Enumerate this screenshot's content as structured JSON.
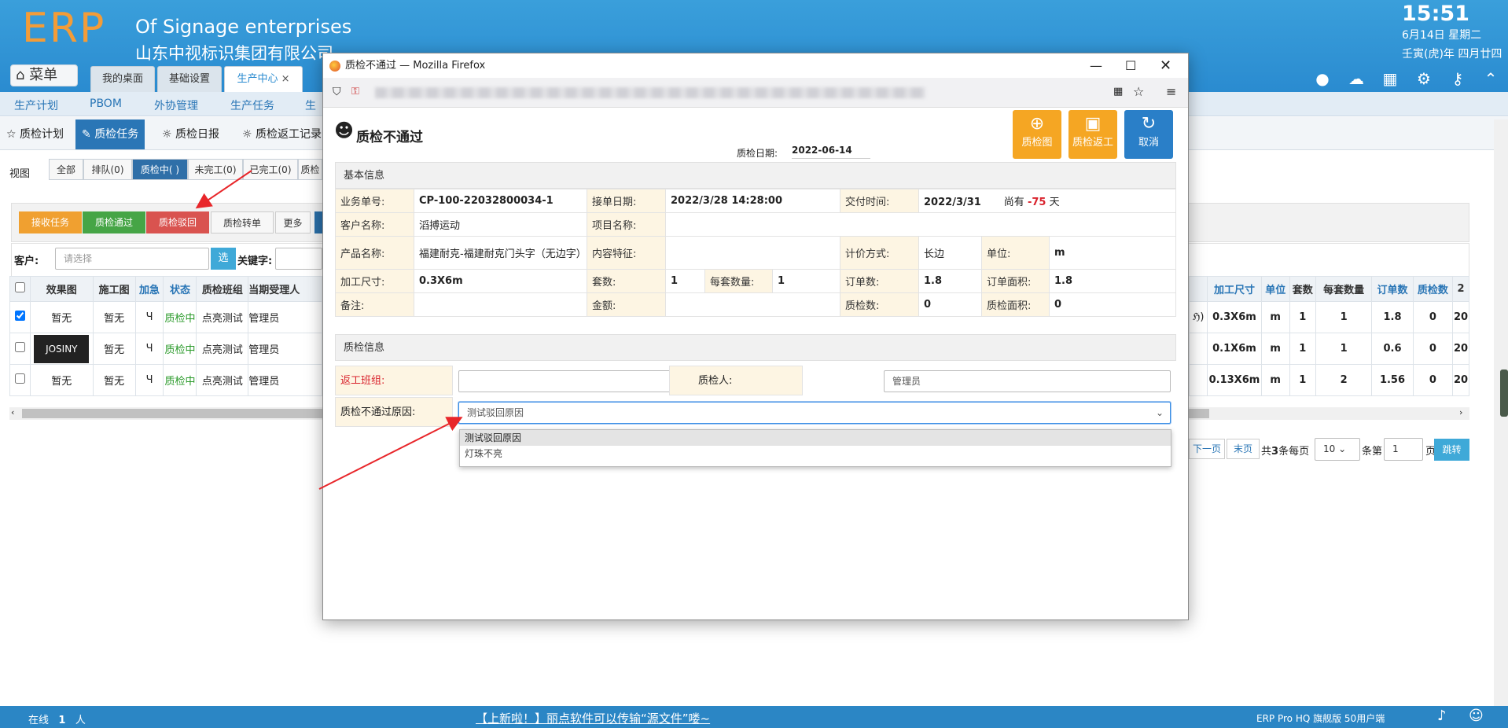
{
  "header": {
    "logo": "ERP",
    "company_en": "Of Signage enterprises",
    "company_cn": "山东中视标识集团有限公司",
    "time": "15:51",
    "date": "6月14日 星期二",
    "lunar": "壬寅(虎)年 四月廿四",
    "menu_label": "菜单",
    "tabs": [
      {
        "label": "我的桌面"
      },
      {
        "label": "基础设置"
      },
      {
        "label": "生产中心"
      }
    ]
  },
  "nav2": {
    "items": [
      "生产计划",
      "PBOM",
      "外协管理",
      "生产任务",
      "生"
    ]
  },
  "nav3": {
    "items": [
      "质检计划",
      "质检任务",
      "质检日报",
      "质检返工记录"
    ]
  },
  "filters": {
    "view_label": "视图",
    "items": [
      "全部",
      "排队(0)",
      "质检中( )",
      "未完工(0)",
      "已完工(0)",
      "质检"
    ]
  },
  "actions": {
    "items": [
      "接收任务",
      "质检通过",
      "质检驳回",
      "质检转单",
      "更多"
    ]
  },
  "search": {
    "customer_label": "客户:",
    "customer_placeholder": "请选择",
    "select_btn": "选",
    "keyword_label": "关键字:"
  },
  "table": {
    "headers_left": [
      "",
      "效果图",
      "施工图",
      "加急",
      "状态",
      "质检班组",
      "当期受理人"
    ],
    "headers_right": [
      "加工尺寸",
      "单位",
      "套数",
      "每套数量",
      "订单数",
      "质检数",
      "2"
    ],
    "rows": [
      {
        "effect": "暂无",
        "drawing": "暂无",
        "urgent": "Ч",
        "status": "质检中",
        "team": "点亮测试",
        "handler": "管理员",
        "tail": "ℌ)",
        "size": "0.3X6m",
        "unit": "m",
        "sets": "1",
        "per": "1",
        "orders": "1.8",
        "qc": "0",
        "x": "20"
      },
      {
        "effect": "JOSINY",
        "drawing": "暂无",
        "urgent": "Ч",
        "status": "质检中",
        "team": "点亮测试",
        "handler": "管理员",
        "tail": "",
        "size": "0.1X6m",
        "unit": "m",
        "sets": "1",
        "per": "1",
        "orders": "0.6",
        "qc": "0",
        "x": "20"
      },
      {
        "effect": "暂无",
        "drawing": "暂无",
        "urgent": "Ч",
        "status": "质检中",
        "team": "点亮测试",
        "handler": "管理员",
        "tail": "",
        "size": "0.13X6m",
        "unit": "m",
        "sets": "1",
        "per": "2",
        "orders": "1.56",
        "qc": "0",
        "x": "20"
      }
    ]
  },
  "pager": {
    "next": "下一页",
    "last": "末页",
    "total_pre": "共",
    "total": "3",
    "total_post": "条每页",
    "per_page": "10",
    "page_pre": "条第",
    "page": "1",
    "page_post": "页",
    "go": "跳转"
  },
  "footer": {
    "online_label": "在线",
    "online_count": "1",
    "online_unit": "人",
    "notice": "【上新啦！】丽点软件可以传输“源文件”喽~",
    "edition": "ERP Pro HQ 旗舰版 50用户端"
  },
  "modal": {
    "window_title": "质检不通过 — Mozilla Firefox",
    "title": "质检不通过",
    "date_label": "质检日期:",
    "date": "2022-06-14",
    "buttons": [
      {
        "label": "质检图",
        "color": "#f5a623"
      },
      {
        "label": "质检返工",
        "color": "#f5a623"
      },
      {
        "label": "取消",
        "color": "#2a7fc8"
      }
    ],
    "basic_title": "基本信息",
    "basic": {
      "order_no_l": "业务单号:",
      "order_no": "CP-100-22032800034-1",
      "recv_date_l": "接单日期:",
      "recv_date": "2022/3/28 14:28:00",
      "deliver_l": "交付时间:",
      "deliver": "2022/3/31",
      "remain_pre": "尚有",
      "remain": "-75",
      "remain_post": "天",
      "customer_l": "客户名称:",
      "customer": "滔搏运动",
      "project_l": "项目名称:",
      "project": "",
      "product_l": "产品名称:",
      "product": "福建耐克-福建耐克门头字（无边字）",
      "feature_l": "内容特征:",
      "feature": "",
      "pricing_l": "计价方式:",
      "pricing": "长边",
      "unit_l": "单位:",
      "unit": "m",
      "size_l": "加工尺寸:",
      "size": "0.3X6m",
      "sets_l": "套数:",
      "sets": "1",
      "per_l": "每套数量:",
      "per": "1",
      "orders_l": "订单数:",
      "orders": "1.8",
      "area_l": "订单面积:",
      "area": "1.8",
      "remark_l": "备注:",
      "remark": "",
      "amount_l": "金额:",
      "amount": "",
      "qc_l": "质检数:",
      "qc": "0",
      "qcarea_l": "质检面积:",
      "qcarea": "0"
    },
    "qc_title": "质检信息",
    "qc": {
      "rework_team_l": "返工班组:",
      "rework_team": "",
      "inspector_l": "质检人:",
      "inspector": "管理员",
      "reason_l": "质检不通过原因:",
      "reason": "测试驳回原因",
      "options": [
        "测试驳回原因",
        "灯珠不亮"
      ]
    }
  }
}
